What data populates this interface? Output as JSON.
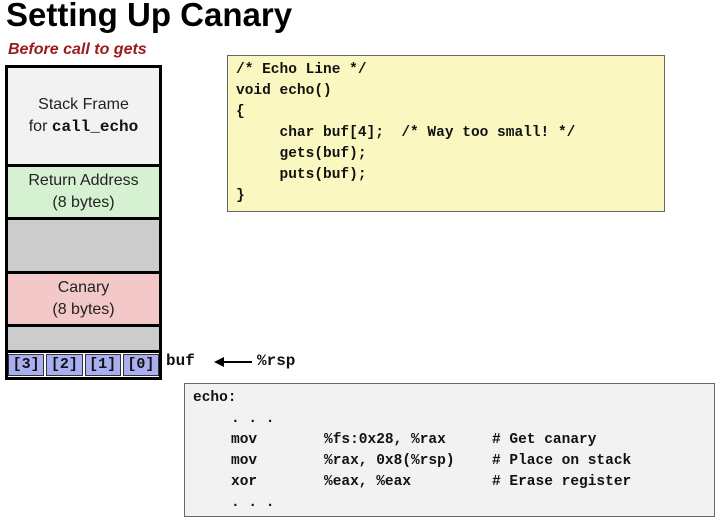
{
  "title": "Setting Up Canary",
  "subtitle": "Before call to gets",
  "stack": {
    "frame_line1": "Stack Frame",
    "frame_line2_prefix": "for ",
    "frame_line2_code": "call_echo",
    "return_line1": "Return Address",
    "return_line2": "(8 bytes)",
    "canary_line1": "Canary",
    "canary_line2": "(8 bytes)",
    "buf_cells": [
      "[3]",
      "[2]",
      "[1]",
      "[0]"
    ],
    "buf_label": "buf",
    "rsp_label": "%rsp"
  },
  "code": {
    "lines": [
      "/* Echo Line */",
      "void echo()",
      "{",
      "     char buf[4];  /* Way too small! */",
      "     gets(buf);",
      "     puts(buf);",
      "}"
    ]
  },
  "asm": {
    "label": "echo:",
    "ellipsis": ". . .",
    "rows": [
      {
        "op": "mov",
        "args": "%fs:0x28, %rax",
        "comment": "# Get canary"
      },
      {
        "op": "mov",
        "args": "%rax, 0x8(%rsp)",
        "comment": "# Place on stack"
      },
      {
        "op": "xor",
        "args": "%eax, %eax",
        "comment": "# Erase register"
      }
    ]
  }
}
